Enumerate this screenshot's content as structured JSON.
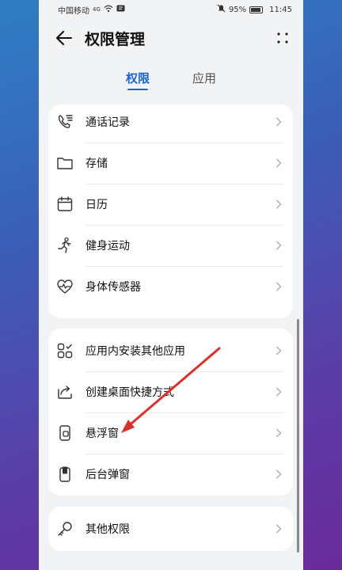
{
  "status": {
    "carrier": "中国移动",
    "net": "4G",
    "battery": "95%",
    "time": "11:45"
  },
  "titlebar": {
    "title": "权限管理"
  },
  "tabs": [
    {
      "label": "权限",
      "active": true
    },
    {
      "label": "应用",
      "active": false
    }
  ],
  "group1": [
    {
      "label": "通话记录",
      "icon": "call-log-icon"
    },
    {
      "label": "存储",
      "icon": "folder-icon"
    },
    {
      "label": "日历",
      "icon": "calendar-icon"
    },
    {
      "label": "健身运动",
      "icon": "running-icon"
    },
    {
      "label": "身体传感器",
      "icon": "heart-rate-icon"
    }
  ],
  "group2": [
    {
      "label": "应用内安装其他应用",
      "icon": "apps-grid-icon"
    },
    {
      "label": "创建桌面快捷方式",
      "icon": "shortcut-icon"
    },
    {
      "label": "悬浮窗",
      "icon": "floating-window-icon"
    },
    {
      "label": "后台弹窗",
      "icon": "popup-icon"
    }
  ],
  "group3": [
    {
      "label": "其他权限",
      "icon": "key-icon"
    }
  ],
  "colors": {
    "accent": "#1a63d8",
    "annotation": "#d9312a"
  }
}
